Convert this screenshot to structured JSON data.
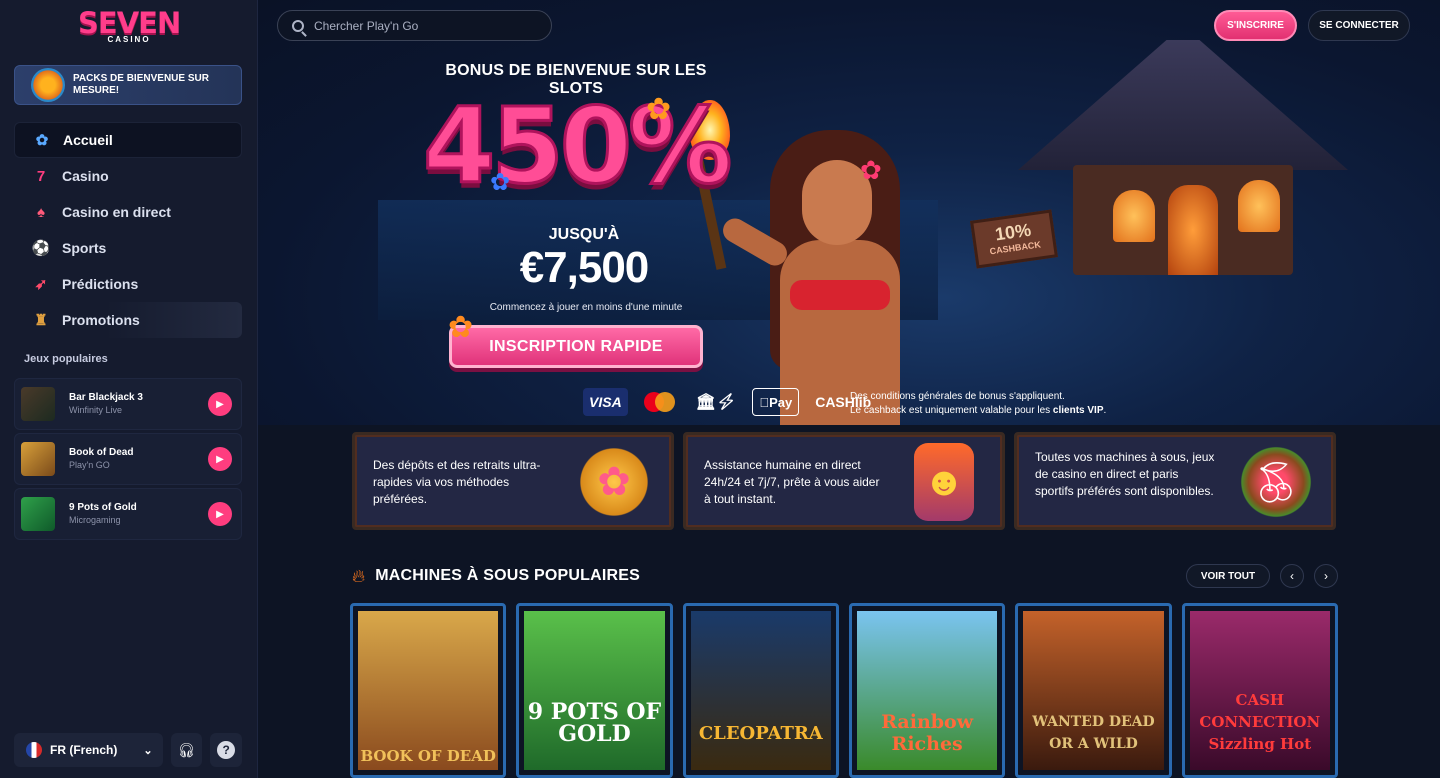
{
  "brand": {
    "name": "SEVEN",
    "sub": "CASINO"
  },
  "header": {
    "search_placeholder": "Chercher Play'n Go",
    "signup_label": "S'INSCRIRE",
    "login_label": "SE CONNECTER"
  },
  "sidebar": {
    "packs_label": "PACKS DE BIENVENUE SUR MESURE!",
    "items": [
      {
        "label": "Accueil",
        "icon": "flower-icon"
      },
      {
        "label": "Casino",
        "icon": "seven-icon"
      },
      {
        "label": "Casino en direct",
        "icon": "spade-icon"
      },
      {
        "label": "Sports",
        "icon": "soccer-ball-icon"
      },
      {
        "label": "Prédictions",
        "icon": "rocket-icon"
      },
      {
        "label": "Promotions",
        "icon": "gift-icon"
      }
    ],
    "popular_label": "Jeux populaires",
    "popular_games": [
      {
        "name": "Bar Blackjack 3",
        "provider": "Winfinity Live",
        "color": "#3a2a1c"
      },
      {
        "name": "Book of Dead",
        "provider": "Play'n GO",
        "color": "#b8832a"
      },
      {
        "name": "9 Pots of Gold",
        "provider": "Microgaming",
        "color": "#1f7a3a"
      }
    ],
    "language": "FR (French)"
  },
  "hero": {
    "bonus_title": "BONUS DE BIENVENUE SUR LES SLOTS",
    "percent": "450%",
    "up_to": "JUSQU'À",
    "amount": "€7,500",
    "subtitle": "Commencez à jouer en moins d'une minute",
    "cta": "INSCRIPTION RAPIDE",
    "cashback_big": "10%",
    "cashback_small": "CASHBACK",
    "payments": [
      "VISA",
      "Mastercard",
      "Bank",
      "Pay",
      "CASHlib"
    ],
    "terms_line1": "Des conditions générales de bonus s'appliquent.",
    "terms_line2": "Le cashback est uniquement valable pour les",
    "terms_bold": "clients VIP",
    "terms_end": "."
  },
  "features": [
    {
      "text": "Des dépôts et des retraits ultra-rapides via vos méthodes préférées.",
      "icon": "coin-flower-icon"
    },
    {
      "text": "Assistance humaine en direct 24h/24 et 7j/7, prête à vous aider à tout instant.",
      "icon": "tiki-mask-icon"
    },
    {
      "text": "Toutes vos machines à sous, jeux de casino en direct et paris sportifs préférés sont disponibles.",
      "icon": "coconut-drink-icon"
    }
  ],
  "slots_section": {
    "title": "MACHINES À SOUS POPULAIRES",
    "view_all": "VOIR TOUT",
    "games": [
      {
        "title": "BOOK OF DEAD",
        "bg": "#8a4a1e",
        "color": "#f1c15a"
      },
      {
        "title": "9 POTS OF GOLD",
        "bg": "#2f8a3a",
        "color": "#ffffff"
      },
      {
        "title": "CLEOPATRA",
        "bg": "#3a2a10",
        "color": "#f7b733"
      },
      {
        "title": "Rainbow Riches",
        "bg": "#4fa0d8",
        "color": "#ff6a3a"
      },
      {
        "title": "WANTED DEAD OR A WILD",
        "bg": "#6b3a1e",
        "color": "#e2c27a"
      },
      {
        "title": "CASH CONNECTION Sizzling Hot",
        "bg": "#6a1a4a",
        "color": "#ff3b3b"
      }
    ]
  }
}
